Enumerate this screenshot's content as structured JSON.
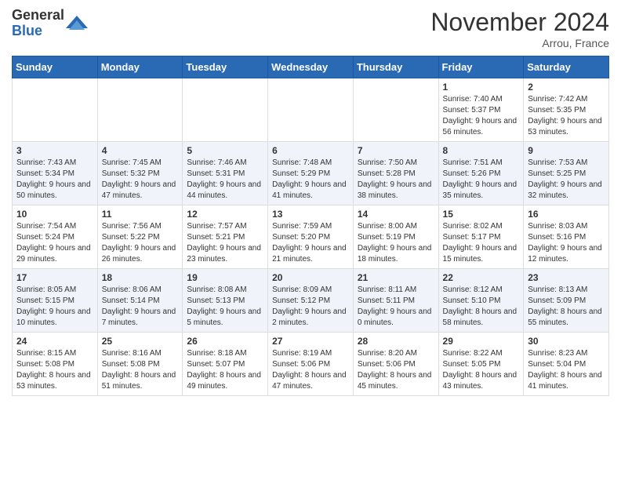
{
  "header": {
    "logo_general": "General",
    "logo_blue": "Blue",
    "month_title": "November 2024",
    "location": "Arrou, France"
  },
  "weekdays": [
    "Sunday",
    "Monday",
    "Tuesday",
    "Wednesday",
    "Thursday",
    "Friday",
    "Saturday"
  ],
  "weeks": [
    [
      {
        "day": "",
        "info": ""
      },
      {
        "day": "",
        "info": ""
      },
      {
        "day": "",
        "info": ""
      },
      {
        "day": "",
        "info": ""
      },
      {
        "day": "",
        "info": ""
      },
      {
        "day": "1",
        "info": "Sunrise: 7:40 AM\nSunset: 5:37 PM\nDaylight: 9 hours and 56 minutes."
      },
      {
        "day": "2",
        "info": "Sunrise: 7:42 AM\nSunset: 5:35 PM\nDaylight: 9 hours and 53 minutes."
      }
    ],
    [
      {
        "day": "3",
        "info": "Sunrise: 7:43 AM\nSunset: 5:34 PM\nDaylight: 9 hours and 50 minutes."
      },
      {
        "day": "4",
        "info": "Sunrise: 7:45 AM\nSunset: 5:32 PM\nDaylight: 9 hours and 47 minutes."
      },
      {
        "day": "5",
        "info": "Sunrise: 7:46 AM\nSunset: 5:31 PM\nDaylight: 9 hours and 44 minutes."
      },
      {
        "day": "6",
        "info": "Sunrise: 7:48 AM\nSunset: 5:29 PM\nDaylight: 9 hours and 41 minutes."
      },
      {
        "day": "7",
        "info": "Sunrise: 7:50 AM\nSunset: 5:28 PM\nDaylight: 9 hours and 38 minutes."
      },
      {
        "day": "8",
        "info": "Sunrise: 7:51 AM\nSunset: 5:26 PM\nDaylight: 9 hours and 35 minutes."
      },
      {
        "day": "9",
        "info": "Sunrise: 7:53 AM\nSunset: 5:25 PM\nDaylight: 9 hours and 32 minutes."
      }
    ],
    [
      {
        "day": "10",
        "info": "Sunrise: 7:54 AM\nSunset: 5:24 PM\nDaylight: 9 hours and 29 minutes."
      },
      {
        "day": "11",
        "info": "Sunrise: 7:56 AM\nSunset: 5:22 PM\nDaylight: 9 hours and 26 minutes."
      },
      {
        "day": "12",
        "info": "Sunrise: 7:57 AM\nSunset: 5:21 PM\nDaylight: 9 hours and 23 minutes."
      },
      {
        "day": "13",
        "info": "Sunrise: 7:59 AM\nSunset: 5:20 PM\nDaylight: 9 hours and 21 minutes."
      },
      {
        "day": "14",
        "info": "Sunrise: 8:00 AM\nSunset: 5:19 PM\nDaylight: 9 hours and 18 minutes."
      },
      {
        "day": "15",
        "info": "Sunrise: 8:02 AM\nSunset: 5:17 PM\nDaylight: 9 hours and 15 minutes."
      },
      {
        "day": "16",
        "info": "Sunrise: 8:03 AM\nSunset: 5:16 PM\nDaylight: 9 hours and 12 minutes."
      }
    ],
    [
      {
        "day": "17",
        "info": "Sunrise: 8:05 AM\nSunset: 5:15 PM\nDaylight: 9 hours and 10 minutes."
      },
      {
        "day": "18",
        "info": "Sunrise: 8:06 AM\nSunset: 5:14 PM\nDaylight: 9 hours and 7 minutes."
      },
      {
        "day": "19",
        "info": "Sunrise: 8:08 AM\nSunset: 5:13 PM\nDaylight: 9 hours and 5 minutes."
      },
      {
        "day": "20",
        "info": "Sunrise: 8:09 AM\nSunset: 5:12 PM\nDaylight: 9 hours and 2 minutes."
      },
      {
        "day": "21",
        "info": "Sunrise: 8:11 AM\nSunset: 5:11 PM\nDaylight: 9 hours and 0 minutes."
      },
      {
        "day": "22",
        "info": "Sunrise: 8:12 AM\nSunset: 5:10 PM\nDaylight: 8 hours and 58 minutes."
      },
      {
        "day": "23",
        "info": "Sunrise: 8:13 AM\nSunset: 5:09 PM\nDaylight: 8 hours and 55 minutes."
      }
    ],
    [
      {
        "day": "24",
        "info": "Sunrise: 8:15 AM\nSunset: 5:08 PM\nDaylight: 8 hours and 53 minutes."
      },
      {
        "day": "25",
        "info": "Sunrise: 8:16 AM\nSunset: 5:08 PM\nDaylight: 8 hours and 51 minutes."
      },
      {
        "day": "26",
        "info": "Sunrise: 8:18 AM\nSunset: 5:07 PM\nDaylight: 8 hours and 49 minutes."
      },
      {
        "day": "27",
        "info": "Sunrise: 8:19 AM\nSunset: 5:06 PM\nDaylight: 8 hours and 47 minutes."
      },
      {
        "day": "28",
        "info": "Sunrise: 8:20 AM\nSunset: 5:06 PM\nDaylight: 8 hours and 45 minutes."
      },
      {
        "day": "29",
        "info": "Sunrise: 8:22 AM\nSunset: 5:05 PM\nDaylight: 8 hours and 43 minutes."
      },
      {
        "day": "30",
        "info": "Sunrise: 8:23 AM\nSunset: 5:04 PM\nDaylight: 8 hours and 41 minutes."
      }
    ]
  ]
}
